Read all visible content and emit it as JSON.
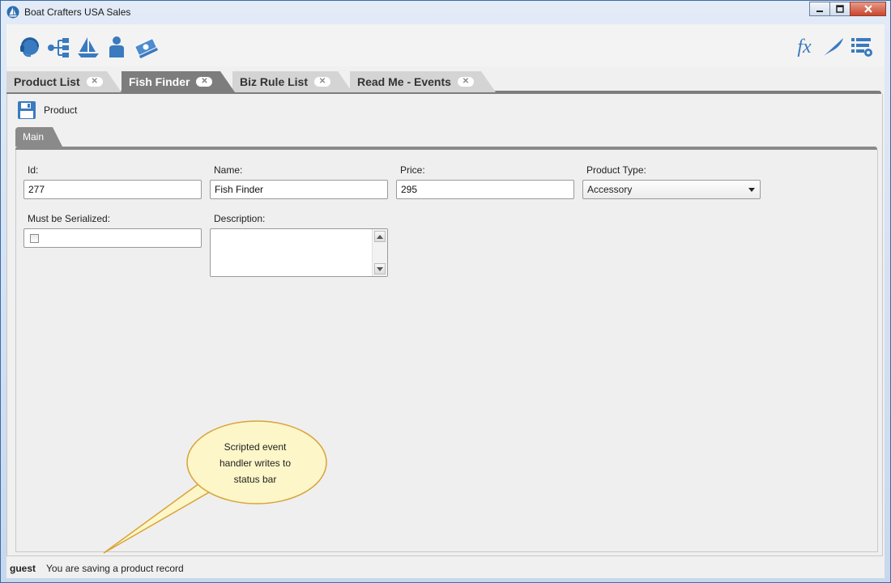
{
  "window": {
    "title": "Boat Crafters USA Sales",
    "controls": {
      "minimize": "minimize",
      "maximize": "maximize",
      "close": "close"
    }
  },
  "toolbar": {
    "left_icons": [
      "headset-icon",
      "sitemap-icon",
      "sailboat-icon",
      "person-icon",
      "money-icon"
    ],
    "right_icons": [
      "function-icon",
      "quill-icon",
      "list-settings-icon"
    ],
    "function_glyph": "fx"
  },
  "tabs": [
    {
      "label": "Product List",
      "active": false
    },
    {
      "label": "Fish Finder",
      "active": true
    },
    {
      "label": "Biz Rule List",
      "active": false
    },
    {
      "label": "Read Me - Events",
      "active": false
    }
  ],
  "record": {
    "save_label": "Product"
  },
  "form_tab": {
    "label": "Main"
  },
  "fields": {
    "id": {
      "label": "Id:",
      "value": "277"
    },
    "name": {
      "label": "Name:",
      "value": "Fish Finder"
    },
    "price": {
      "label": "Price:",
      "value": "295"
    },
    "product_type": {
      "label": "Product Type:",
      "value": "Accessory"
    },
    "must_be_serialized": {
      "label": "Must be Serialized:",
      "checked": false
    },
    "description": {
      "label": "Description:",
      "value": ""
    }
  },
  "status": {
    "user": "guest",
    "message": "You are saving a product record"
  },
  "callout": {
    "text": "Scripted event handler writes to status bar"
  },
  "colors": {
    "accent": "#3a7abf",
    "active_tab": "#7d7d7d",
    "callout_fill": "#fdf6c8",
    "callout_stroke": "#d9a33a"
  }
}
